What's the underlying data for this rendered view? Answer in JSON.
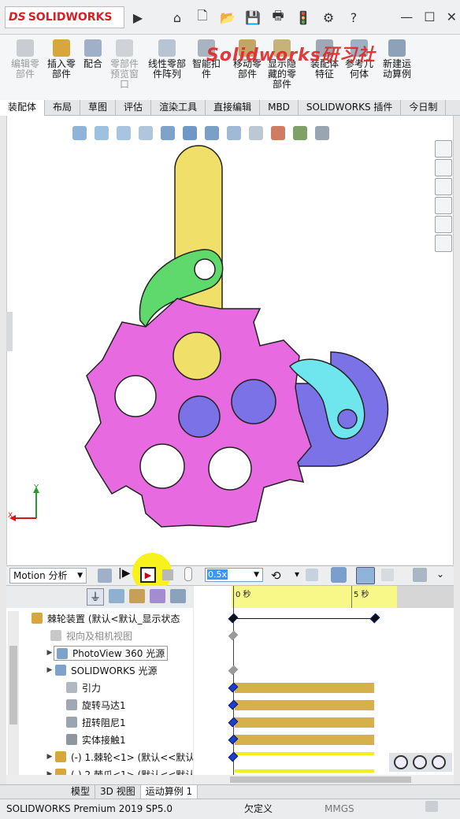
{
  "app": {
    "logo_ds": "DS",
    "logo_text": "SOLIDWORKS"
  },
  "watermark": "Solidworks研习社",
  "commands": [
    {
      "label": "编辑零\n部件",
      "disabled": true
    },
    {
      "label": "插入零\n部件",
      "disabled": false
    },
    {
      "label": "配合",
      "disabled": false
    },
    {
      "label": "零部件\n预览窗\n口",
      "disabled": true
    },
    {
      "label": "线性零部\n件阵列",
      "disabled": false
    },
    {
      "label": "智能扣\n件",
      "disabled": false
    },
    {
      "label": "移动零\n部件",
      "disabled": false
    },
    {
      "label": "显示隐\n藏的零\n部件",
      "disabled": false
    },
    {
      "label": "装配体\n特征",
      "disabled": false
    },
    {
      "label": "参考几\n何体",
      "disabled": false
    },
    {
      "label": "新建运\n动算例",
      "disabled": false
    }
  ],
  "tabs": [
    "装配体",
    "布局",
    "草图",
    "评估",
    "渲染工具",
    "直接编辑",
    "MBD",
    "SOLIDWORKS 插件",
    "今日制"
  ],
  "motion": {
    "study_type": "Motion 分析",
    "speed": "0.5x",
    "ruler": [
      "0 秒",
      "5 秒"
    ]
  },
  "tree": [
    {
      "label": "棘轮装置 (默认<默认_显示状态",
      "expand": "▼",
      "grey": false,
      "boxed": false
    },
    {
      "label": "视向及相机视图",
      "expand": "",
      "grey": true,
      "boxed": false
    },
    {
      "label": "PhotoView 360 光源",
      "expand": "▶",
      "grey": false,
      "boxed": true
    },
    {
      "label": "SOLIDWORKS 光源",
      "expand": "▶",
      "grey": false,
      "boxed": false
    },
    {
      "label": "引力",
      "expand": "",
      "grey": false,
      "boxed": false
    },
    {
      "label": "旋转马达1",
      "expand": "",
      "grey": false,
      "boxed": false
    },
    {
      "label": "扭转阻尼1",
      "expand": "",
      "grey": false,
      "boxed": false
    },
    {
      "label": "实体接触1",
      "expand": "",
      "grey": false,
      "boxed": false
    },
    {
      "label": "(-) 1.棘轮<1> (默认<<默认",
      "expand": "▶",
      "grey": false,
      "boxed": false
    },
    {
      "label": "(-) 2.棘爪<1> (默认<<默认",
      "expand": "▶",
      "grey": false,
      "boxed": false
    }
  ],
  "bottom_tabs": [
    "模型",
    "3D 视图",
    "运动算例 1"
  ],
  "status": {
    "left": "SOLIDWORKS Premium 2019 SP5.0",
    "mid": "欠定义",
    "units": "MMGS"
  },
  "axes": {
    "x": "X",
    "y": "Y"
  },
  "colors": {
    "pink": "#e86ae0",
    "yellow": "#f0e06a",
    "purple": "#7b72e8",
    "green": "#5fd96b",
    "cyan": "#6fe6ee",
    "accent": "#d42026"
  }
}
